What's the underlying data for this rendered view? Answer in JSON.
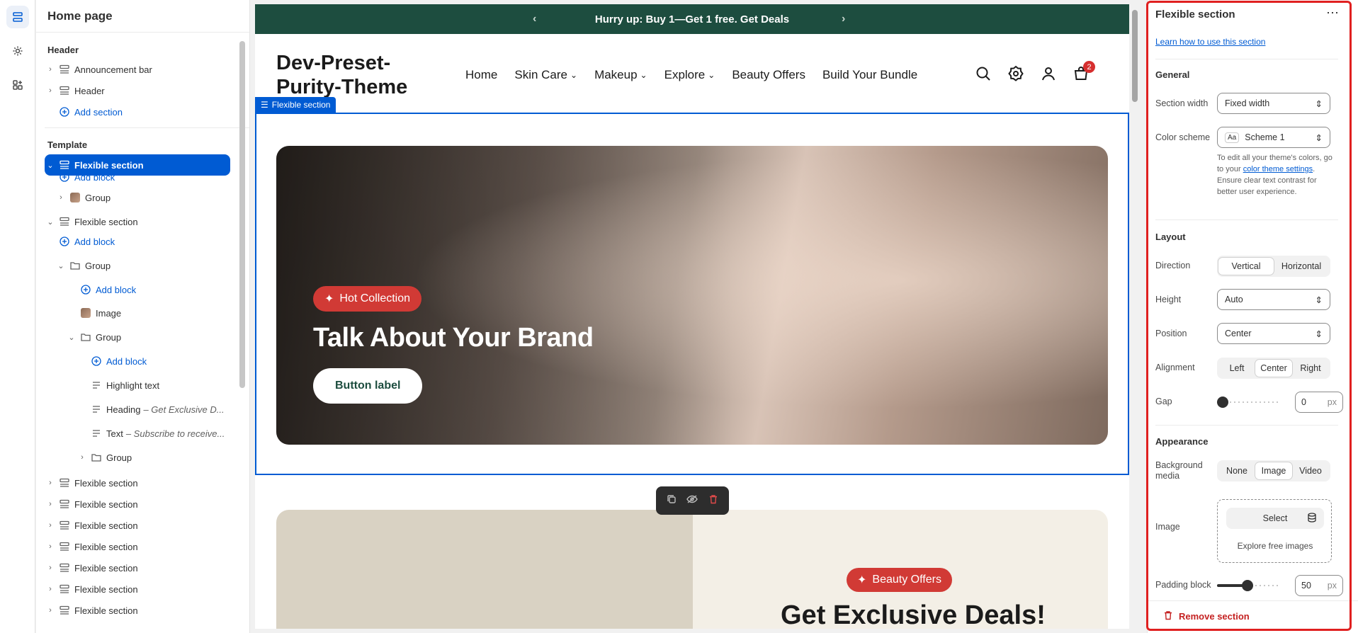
{
  "tree": {
    "title": "Home page",
    "header_group": "Header",
    "header_items": [
      "Announcement bar",
      "Header"
    ],
    "add_section": "Add section",
    "template_group": "Template",
    "selected": "Flexible section",
    "rows": [
      {
        "label": "Add block"
      },
      {
        "label": "Group"
      },
      {
        "label": "Flexible section"
      },
      {
        "label": "Add block"
      },
      {
        "label": "Group"
      },
      {
        "label": "Add block"
      },
      {
        "label": "Image"
      },
      {
        "label": "Group"
      },
      {
        "label": "Add block"
      },
      {
        "label": "Highlight text"
      },
      {
        "label": "Heading",
        "detail": "– Get Exclusive D..."
      },
      {
        "label": "Text",
        "detail": "– Subscribe to receive..."
      },
      {
        "label": "Group"
      },
      {
        "label": "Flexible section"
      },
      {
        "label": "Flexible section"
      },
      {
        "label": "Flexible section"
      },
      {
        "label": "Flexible section"
      },
      {
        "label": "Flexible section"
      },
      {
        "label": "Flexible section"
      },
      {
        "label": "Flexible section"
      }
    ]
  },
  "preview": {
    "announcement": "Hurry up: Buy 1—Get 1 free. Get Deals",
    "logo": "Dev-Preset-Purity-Theme",
    "nav": [
      "Home",
      "Skin Care",
      "Makeup",
      "Explore",
      "Beauty Offers",
      "Build Your Bundle"
    ],
    "cart_count": "2",
    "section_tag": "Flexible section",
    "hero_pill": "Hot Collection",
    "hero_heading": "Talk About Your Brand",
    "hero_button": "Button label",
    "card2_pill": "Beauty Offers",
    "card2_heading": "Get Exclusive Deals!"
  },
  "panel": {
    "title": "Flexible section",
    "learn": "Learn how to use this section",
    "general": "General",
    "section_width_label": "Section width",
    "section_width_value": "Fixed width",
    "color_scheme_label": "Color scheme",
    "color_scheme_value": "Scheme 1",
    "note_a": "To edit all your theme's colors, go to your",
    "note_link": "color theme settings",
    "note_b": ". Ensure clear text contrast for better user experience.",
    "layout": "Layout",
    "direction_label": "Direction",
    "direction_options": [
      "Vertical",
      "Horizontal"
    ],
    "height_label": "Height",
    "height_value": "Auto",
    "position_label": "Position",
    "position_value": "Center",
    "alignment_label": "Alignment",
    "alignment_options": [
      "Left",
      "Center",
      "Right"
    ],
    "gap_label": "Gap",
    "gap_value": "0",
    "gap_fraction": 0,
    "unit": "px",
    "appearance": "Appearance",
    "bg_media_label": "Background media",
    "bg_media_options": [
      "None",
      "Image",
      "Video"
    ],
    "image_label": "Image",
    "select_btn": "Select",
    "explore": "Explore free images",
    "padding_label": "Padding block",
    "padding_value": "50",
    "padding_fraction": 0.5,
    "remove": "Remove section"
  }
}
